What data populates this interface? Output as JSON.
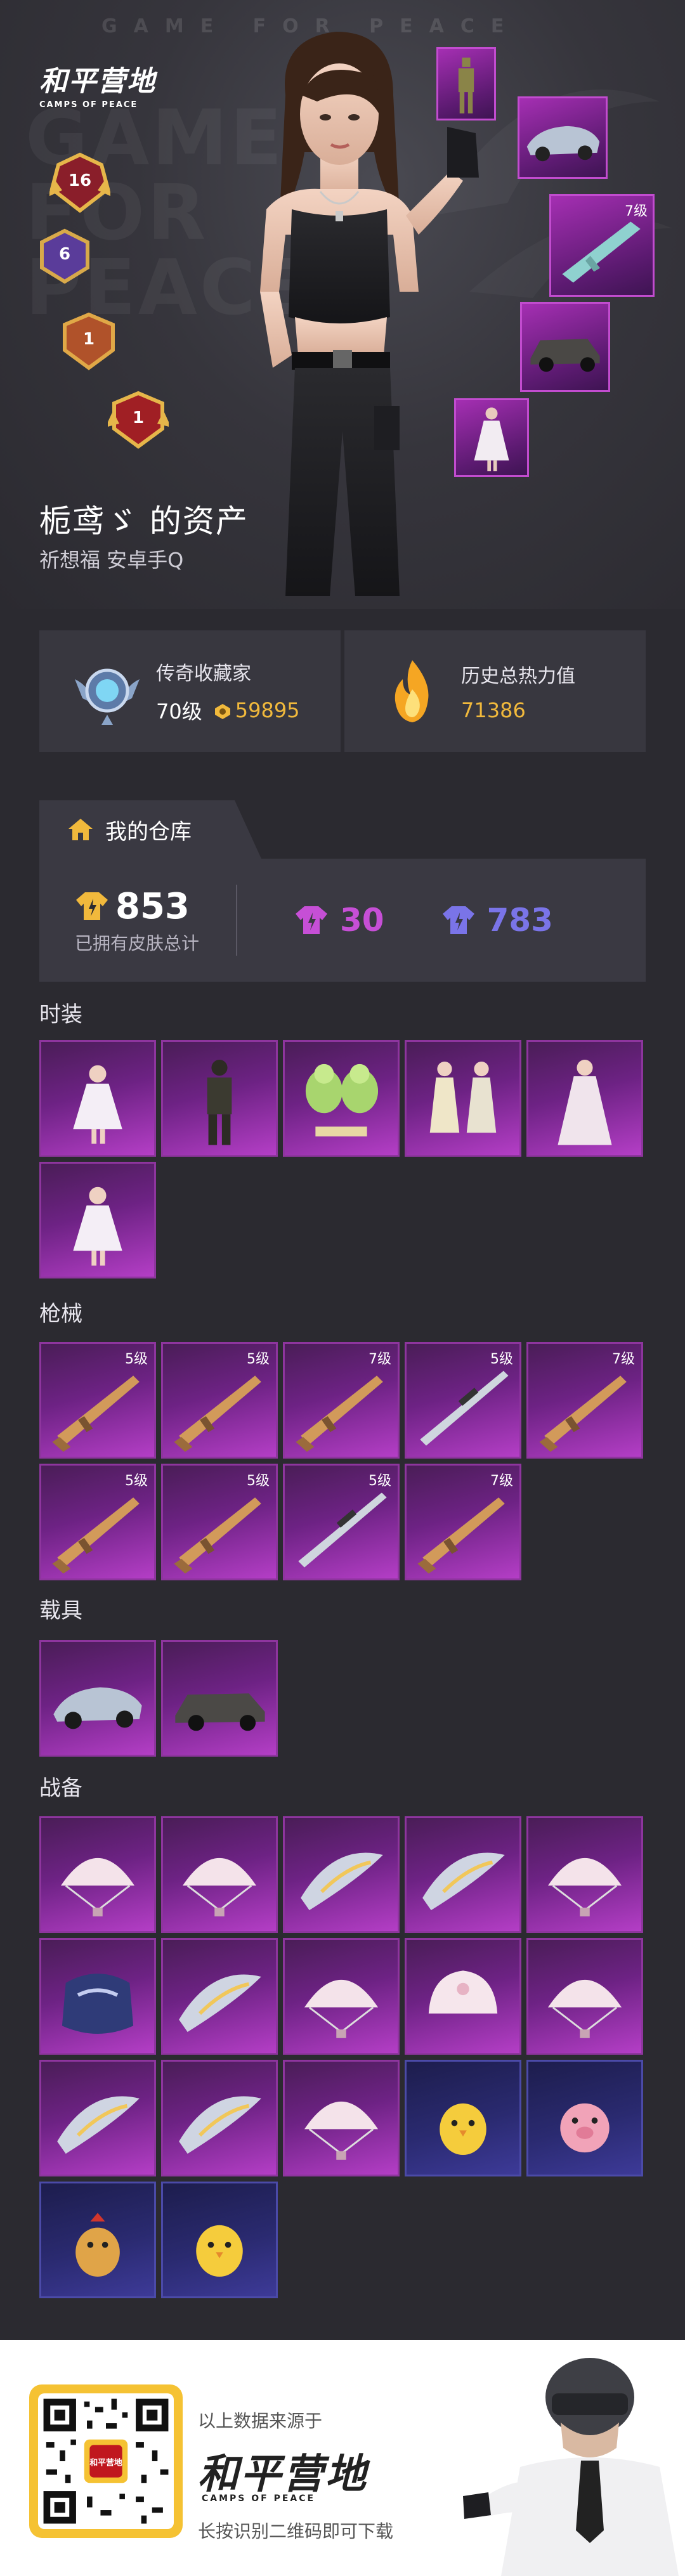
{
  "hero": {
    "bg_tagline": "GAME FOR PEACE",
    "bg_words": [
      "GAME",
      "FOR",
      "PEACE"
    ],
    "logo_cn": "和平营地",
    "logo_en": "CAMPS OF PEACE",
    "rank_badges": [
      "16",
      "6",
      "1",
      "1"
    ],
    "showcase_items": [
      {
        "icon": "outfit-icon",
        "level": ""
      },
      {
        "icon": "vehicle-icon",
        "level": ""
      },
      {
        "icon": "rifle-icon",
        "level": "7级"
      },
      {
        "icon": "car-icon",
        "level": ""
      },
      {
        "icon": "outfit-icon",
        "level": ""
      }
    ],
    "player_name": "栀鸢ゞ 的资产",
    "player_sub": "祈想福   安卓手Q"
  },
  "stats": {
    "collector_label": "传奇收藏家",
    "collector_level": "70级",
    "collector_points": "59895",
    "heat_label": "历史总热力值",
    "heat_value": "71386"
  },
  "warehouse": {
    "tab_label": "我的仓库",
    "total": "853",
    "total_label": "已拥有皮肤总计",
    "purple_count": "30",
    "blue_count": "783",
    "colors": {
      "gold": "#f1b93c",
      "purple": "#c64fd6",
      "blue": "#7a74e8"
    }
  },
  "sections": [
    {
      "label": "时装",
      "items": [
        {
          "rarity": "purple",
          "icon": "dress-outfit-icon",
          "level": ""
        },
        {
          "rarity": "purple",
          "icon": "tactical-outfit-icon",
          "level": ""
        },
        {
          "rarity": "purple",
          "icon": "mascot-outfit-icon",
          "level": ""
        },
        {
          "rarity": "purple",
          "icon": "couple-outfit-icon",
          "level": ""
        },
        {
          "rarity": "purple",
          "icon": "gown-outfit-icon",
          "level": ""
        },
        {
          "rarity": "purple",
          "icon": "dress-outfit-icon",
          "level": ""
        }
      ]
    },
    {
      "label": "枪械",
      "items": [
        {
          "rarity": "purple",
          "icon": "rifle-icon",
          "level": "5级"
        },
        {
          "rarity": "purple",
          "icon": "rifle-icon",
          "level": "5级"
        },
        {
          "rarity": "purple",
          "icon": "rifle-icon",
          "level": "7级"
        },
        {
          "rarity": "purple",
          "icon": "sniper-icon",
          "level": "5级"
        },
        {
          "rarity": "purple",
          "icon": "rifle-icon",
          "level": "7级"
        },
        {
          "rarity": "purple",
          "icon": "rifle-icon",
          "level": "5级"
        },
        {
          "rarity": "purple",
          "icon": "rifle-icon",
          "level": "5级"
        },
        {
          "rarity": "purple",
          "icon": "sniper-icon",
          "level": "5级"
        },
        {
          "rarity": "purple",
          "icon": "rifle-icon",
          "level": "7级"
        }
      ]
    },
    {
      "label": "载具",
      "items": [
        {
          "rarity": "purple",
          "icon": "race-car-icon",
          "level": ""
        },
        {
          "rarity": "purple",
          "icon": "sedan-icon",
          "level": ""
        }
      ]
    },
    {
      "label": "战备",
      "items": [
        {
          "rarity": "purple",
          "icon": "parachute-icon",
          "level": ""
        },
        {
          "rarity": "purple",
          "icon": "parachute-icon",
          "level": ""
        },
        {
          "rarity": "purple",
          "icon": "glider-icon",
          "level": ""
        },
        {
          "rarity": "purple",
          "icon": "glider-icon",
          "level": ""
        },
        {
          "rarity": "purple",
          "icon": "parachute-icon",
          "level": ""
        },
        {
          "rarity": "purple",
          "icon": "backpack-icon",
          "level": ""
        },
        {
          "rarity": "purple",
          "icon": "glider-icon",
          "level": ""
        },
        {
          "rarity": "purple",
          "icon": "parachute-icon",
          "level": ""
        },
        {
          "rarity": "purple",
          "icon": "helmet-icon",
          "level": ""
        },
        {
          "rarity": "purple",
          "icon": "parachute-icon",
          "level": ""
        },
        {
          "rarity": "purple",
          "icon": "glider-icon",
          "level": ""
        },
        {
          "rarity": "purple",
          "icon": "glider-icon",
          "level": ""
        },
        {
          "rarity": "purple",
          "icon": "parachute-icon",
          "level": ""
        },
        {
          "rarity": "blue",
          "icon": "chick-pet-icon",
          "level": ""
        },
        {
          "rarity": "blue",
          "icon": "pig-pet-icon",
          "level": ""
        },
        {
          "rarity": "blue",
          "icon": "rooster-pet-icon",
          "level": ""
        },
        {
          "rarity": "blue",
          "icon": "chick-pet-icon",
          "level": ""
        }
      ]
    }
  ],
  "footer": {
    "source": "以上数据来源于",
    "logo_cn": "和平营地",
    "logo_en": "CAMPS OF PEACE",
    "qr_badge": "和平营地",
    "scan": "长按识别二维码即可下载"
  }
}
